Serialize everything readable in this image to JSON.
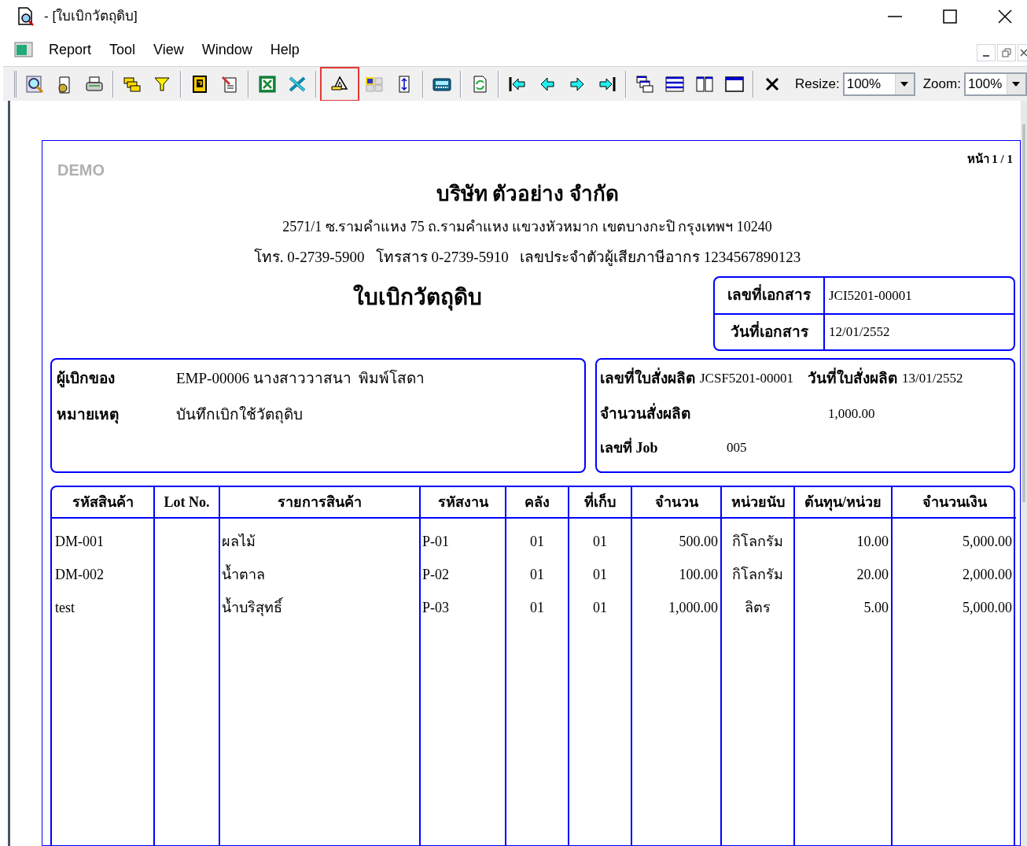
{
  "window": {
    "title": "- [ใบเบิกวัตถุดิบ]"
  },
  "menu": [
    "Report",
    "Tool",
    "View",
    "Window",
    "Help"
  ],
  "toolbar": {
    "buttons": [
      {
        "kind": "preview",
        "hovered": false
      },
      {
        "kind": "setup",
        "hovered": false
      },
      {
        "kind": "print",
        "hovered": false
      },
      {
        "kind": "separator"
      },
      {
        "kind": "copies",
        "hovered": false
      },
      {
        "kind": "filter",
        "hovered": false
      },
      {
        "kind": "separator"
      },
      {
        "kind": "help",
        "hovered": false
      },
      {
        "kind": "edit",
        "hovered": false
      },
      {
        "kind": "separator"
      },
      {
        "kind": "excel",
        "hovered": false
      },
      {
        "kind": "export",
        "hovered": false
      },
      {
        "kind": "separator"
      },
      {
        "kind": "designer",
        "hovered": true
      },
      {
        "kind": "grid",
        "hovered": false
      },
      {
        "kind": "fit",
        "hovered": false
      },
      {
        "kind": "separator"
      },
      {
        "kind": "calculator",
        "hovered": false
      },
      {
        "kind": "separator"
      },
      {
        "kind": "refresh",
        "hovered": false
      },
      {
        "kind": "separator"
      },
      {
        "kind": "first",
        "hovered": false
      },
      {
        "kind": "prev",
        "hovered": false
      },
      {
        "kind": "next",
        "hovered": false
      },
      {
        "kind": "last",
        "hovered": false
      },
      {
        "kind": "separator"
      },
      {
        "kind": "cascade",
        "hovered": false
      },
      {
        "kind": "rows",
        "hovered": false
      },
      {
        "kind": "columns",
        "hovered": false
      },
      {
        "kind": "single",
        "hovered": false
      },
      {
        "kind": "separator"
      },
      {
        "kind": "close",
        "hovered": false
      }
    ],
    "resize_label": "Resize:",
    "resize_value": "100%",
    "zoom_label": "Zoom:",
    "zoom_value": "100%"
  },
  "report": {
    "watermark": "DEMO",
    "page": "หน้า 1 / 1",
    "company": "บริษัท ตัวอย่าง จำกัด",
    "address": "2571/1 ซ.รามคำแหง 75 ถ.รามคำแหง แขวงหัวหมาก เขตบางกะปิ กรุงเทพฯ 10240",
    "contact": "โทร. 0-2739-5900   โทรสาร 0-2739-5910   เลขประจำตัวผู้เสียภาษีอากร 1234567890123",
    "title": "ใบเบิกวัตถุดิบ",
    "doc_fields": [
      {
        "label": "เลขที่เอกสาร",
        "value": "JCI5201-00001"
      },
      {
        "label": "วันที่เอกสาร",
        "value": "12/01/2552"
      }
    ],
    "requester_label": "ผู้เบิกของ",
    "requester": "EMP-00006 นางสาววาสนา  พิมพ์โสดา",
    "note_label": "หมายเหตุ",
    "note": "บันทึกเบิกใช้วัตถุดิบ",
    "order_no_label": "เลขที่ใบสั่งผลิต",
    "order_no": "JCSF5201-00001",
    "order_date_label": "วันที่ใบสั่งผลิต",
    "order_date": "13/01/2552",
    "qty_label": "จำนวนสั่งผลิต",
    "qty": "1,000.00",
    "job_label": "เลขที่ Job",
    "job": "005",
    "table": {
      "columns": [
        "รหัสสินค้า",
        "Lot No.",
        "รายการสินค้า",
        "รหัสงาน",
        "คลัง",
        "ที่เก็บ",
        "จำนวน",
        "หน่วยนับ",
        "ต้นทุน/หน่วย",
        "จำนวนเงิน"
      ],
      "rows": [
        [
          "DM-001",
          "",
          "ผลไม้",
          "P-01",
          "01",
          "01",
          "500.00",
          "กิโลกรัม",
          "10.00",
          "5,000.00"
        ],
        [
          "DM-002",
          "",
          "น้ำตาล",
          "P-02",
          "01",
          "01",
          "100.00",
          "กิโลกรัม",
          "20.00",
          "2,000.00"
        ],
        [
          "test",
          "",
          "น้ำบริสุทธิ์",
          "P-03",
          "01",
          "01",
          "1,000.00",
          "ลิตร",
          "5.00",
          "5,000.00"
        ]
      ]
    }
  }
}
